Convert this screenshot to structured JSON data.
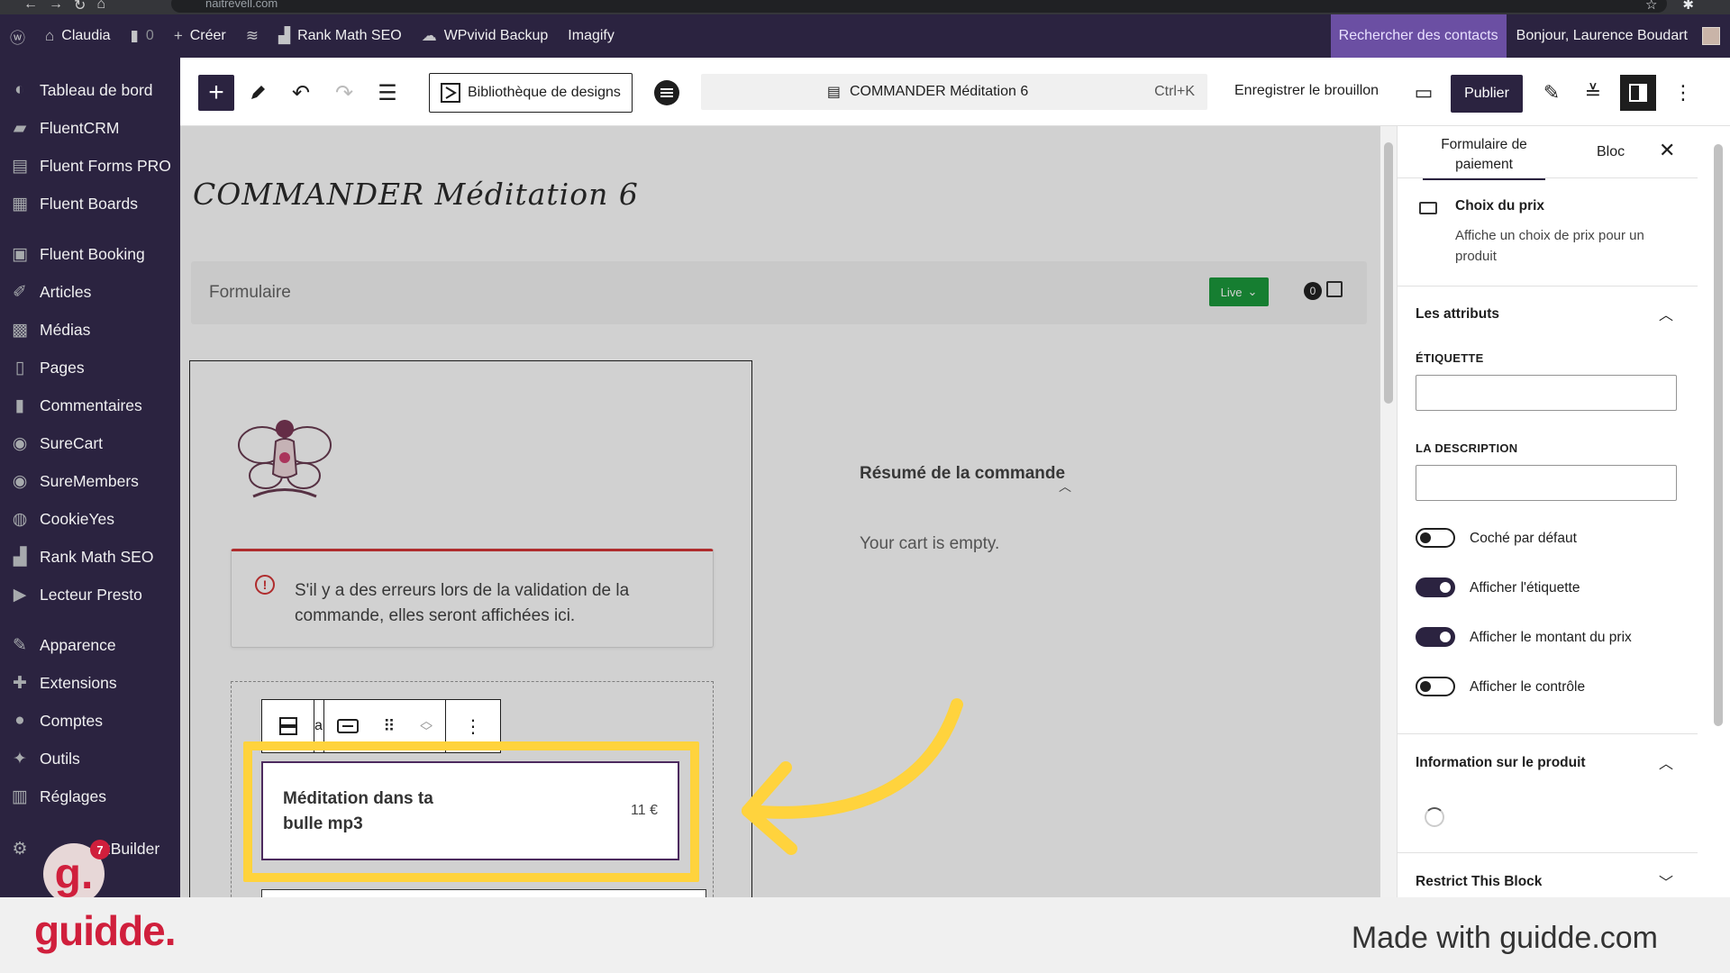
{
  "browser": {
    "url": "naitrevell.com"
  },
  "adminbar": {
    "site": "Claudia",
    "comments": "0",
    "create": "Créer",
    "items": [
      "Rank Math SEO",
      "WPvivid Backup",
      "Imagify"
    ],
    "search": "Rechercher des contacts",
    "greeting": "Bonjour, Laurence Boudart"
  },
  "sidebar": {
    "items": [
      {
        "label": "Tableau de bord",
        "icon": "dashboard-icon"
      },
      {
        "label": "FluentCRM",
        "icon": "fluentcrm-icon"
      },
      {
        "label": "Fluent Forms PRO",
        "icon": "forms-icon"
      },
      {
        "label": "Fluent Boards",
        "icon": "boards-icon"
      },
      {
        "label": "Fluent Booking",
        "icon": "booking-icon"
      },
      {
        "label": "Articles",
        "icon": "pin-icon"
      },
      {
        "label": "Médias",
        "icon": "media-icon"
      },
      {
        "label": "Pages",
        "icon": "pages-icon"
      },
      {
        "label": "Commentaires",
        "icon": "comments-icon"
      },
      {
        "label": "SureCart",
        "icon": "surecart-icon"
      },
      {
        "label": "SureMembers",
        "icon": "suremembers-icon"
      },
      {
        "label": "CookieYes",
        "icon": "cookie-icon"
      },
      {
        "label": "Rank Math SEO",
        "icon": "rankmath-icon"
      },
      {
        "label": "Lecteur Presto",
        "icon": "presto-icon"
      },
      {
        "label": "Apparence",
        "icon": "brush-icon"
      },
      {
        "label": "Extensions",
        "icon": "plugin-icon"
      },
      {
        "label": "Comptes",
        "icon": "user-icon"
      },
      {
        "label": "Outils",
        "icon": "wrench-icon"
      },
      {
        "label": "Réglages",
        "icon": "settings-icon"
      },
      {
        "label": "SeedProd Builder",
        "icon": "gear-icon"
      }
    ],
    "partial_label": "zBuilder"
  },
  "editor": {
    "library": "Bibliothèque de designs",
    "doc_title": "COMMANDER Méditation 6",
    "shortcut": "Ctrl+K",
    "save_draft": "Enregistrer le brouillon",
    "publish": "Publier"
  },
  "canvas": {
    "post_title": "COMMANDER Méditation 6",
    "form_label": "Formulaire",
    "live": "Live",
    "cart_count": "0",
    "error_text": "S'il y a des erreurs lors de la validation de la commande, elles seront affichées ici.",
    "block_partial": "a",
    "price_name": "Méditation dans ta bulle mp3",
    "price_value": "11 €",
    "summary_title": "Résumé de la commande",
    "summary_empty": "Your cart is empty."
  },
  "panel": {
    "tab_form": "Formulaire de paiement",
    "tab_block": "Bloc",
    "block_name": "Choix du prix",
    "block_desc": "Affiche un choix de prix pour un produit",
    "attributes_title": "Les attributs",
    "label_field": "ÉTIQUETTE",
    "desc_field": "LA DESCRIPTION",
    "toggles": [
      {
        "label": "Coché par défaut",
        "on": false
      },
      {
        "label": "Afficher l'étiquette",
        "on": true
      },
      {
        "label": "Afficher le montant du prix",
        "on": true
      },
      {
        "label": "Afficher le contrôle",
        "on": false
      }
    ],
    "product_info_title": "Information sur le produit",
    "restrict_title": "Restrict This Block"
  },
  "footer": {
    "logo": "guidde.",
    "made_with": "Made with guidde.com",
    "badge_count": "7"
  },
  "colors": {
    "admin": "#2b2340",
    "highlight": "#ffd33d",
    "brand": "#d01f3c",
    "live": "#1b9a3c"
  }
}
